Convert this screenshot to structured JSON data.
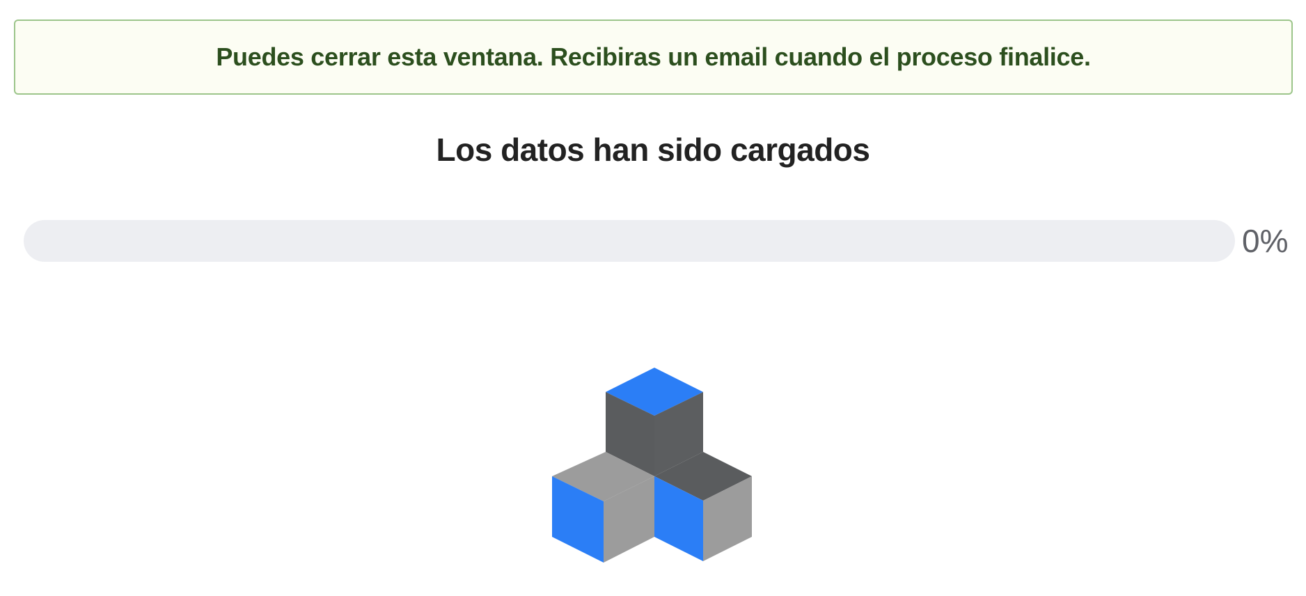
{
  "notice": {
    "message": "Puedes cerrar esta ventana. Recibiras un email cuando el proceso finalice."
  },
  "status": {
    "title": "Los datos han sido cargados"
  },
  "progress": {
    "value_percent": 0,
    "label": "0%"
  },
  "loader": {
    "icon": "stacked-cubes-loader-icon",
    "colors": {
      "blue": "#2b7ef6",
      "dark_gray": "#5a5c5e",
      "light_gray": "#9c9c9c"
    }
  },
  "colors": {
    "notice_border": "#9cc58a",
    "notice_background": "#fcfdf3",
    "notice_text": "#2c4f1e",
    "progress_track": "#edeef2"
  }
}
